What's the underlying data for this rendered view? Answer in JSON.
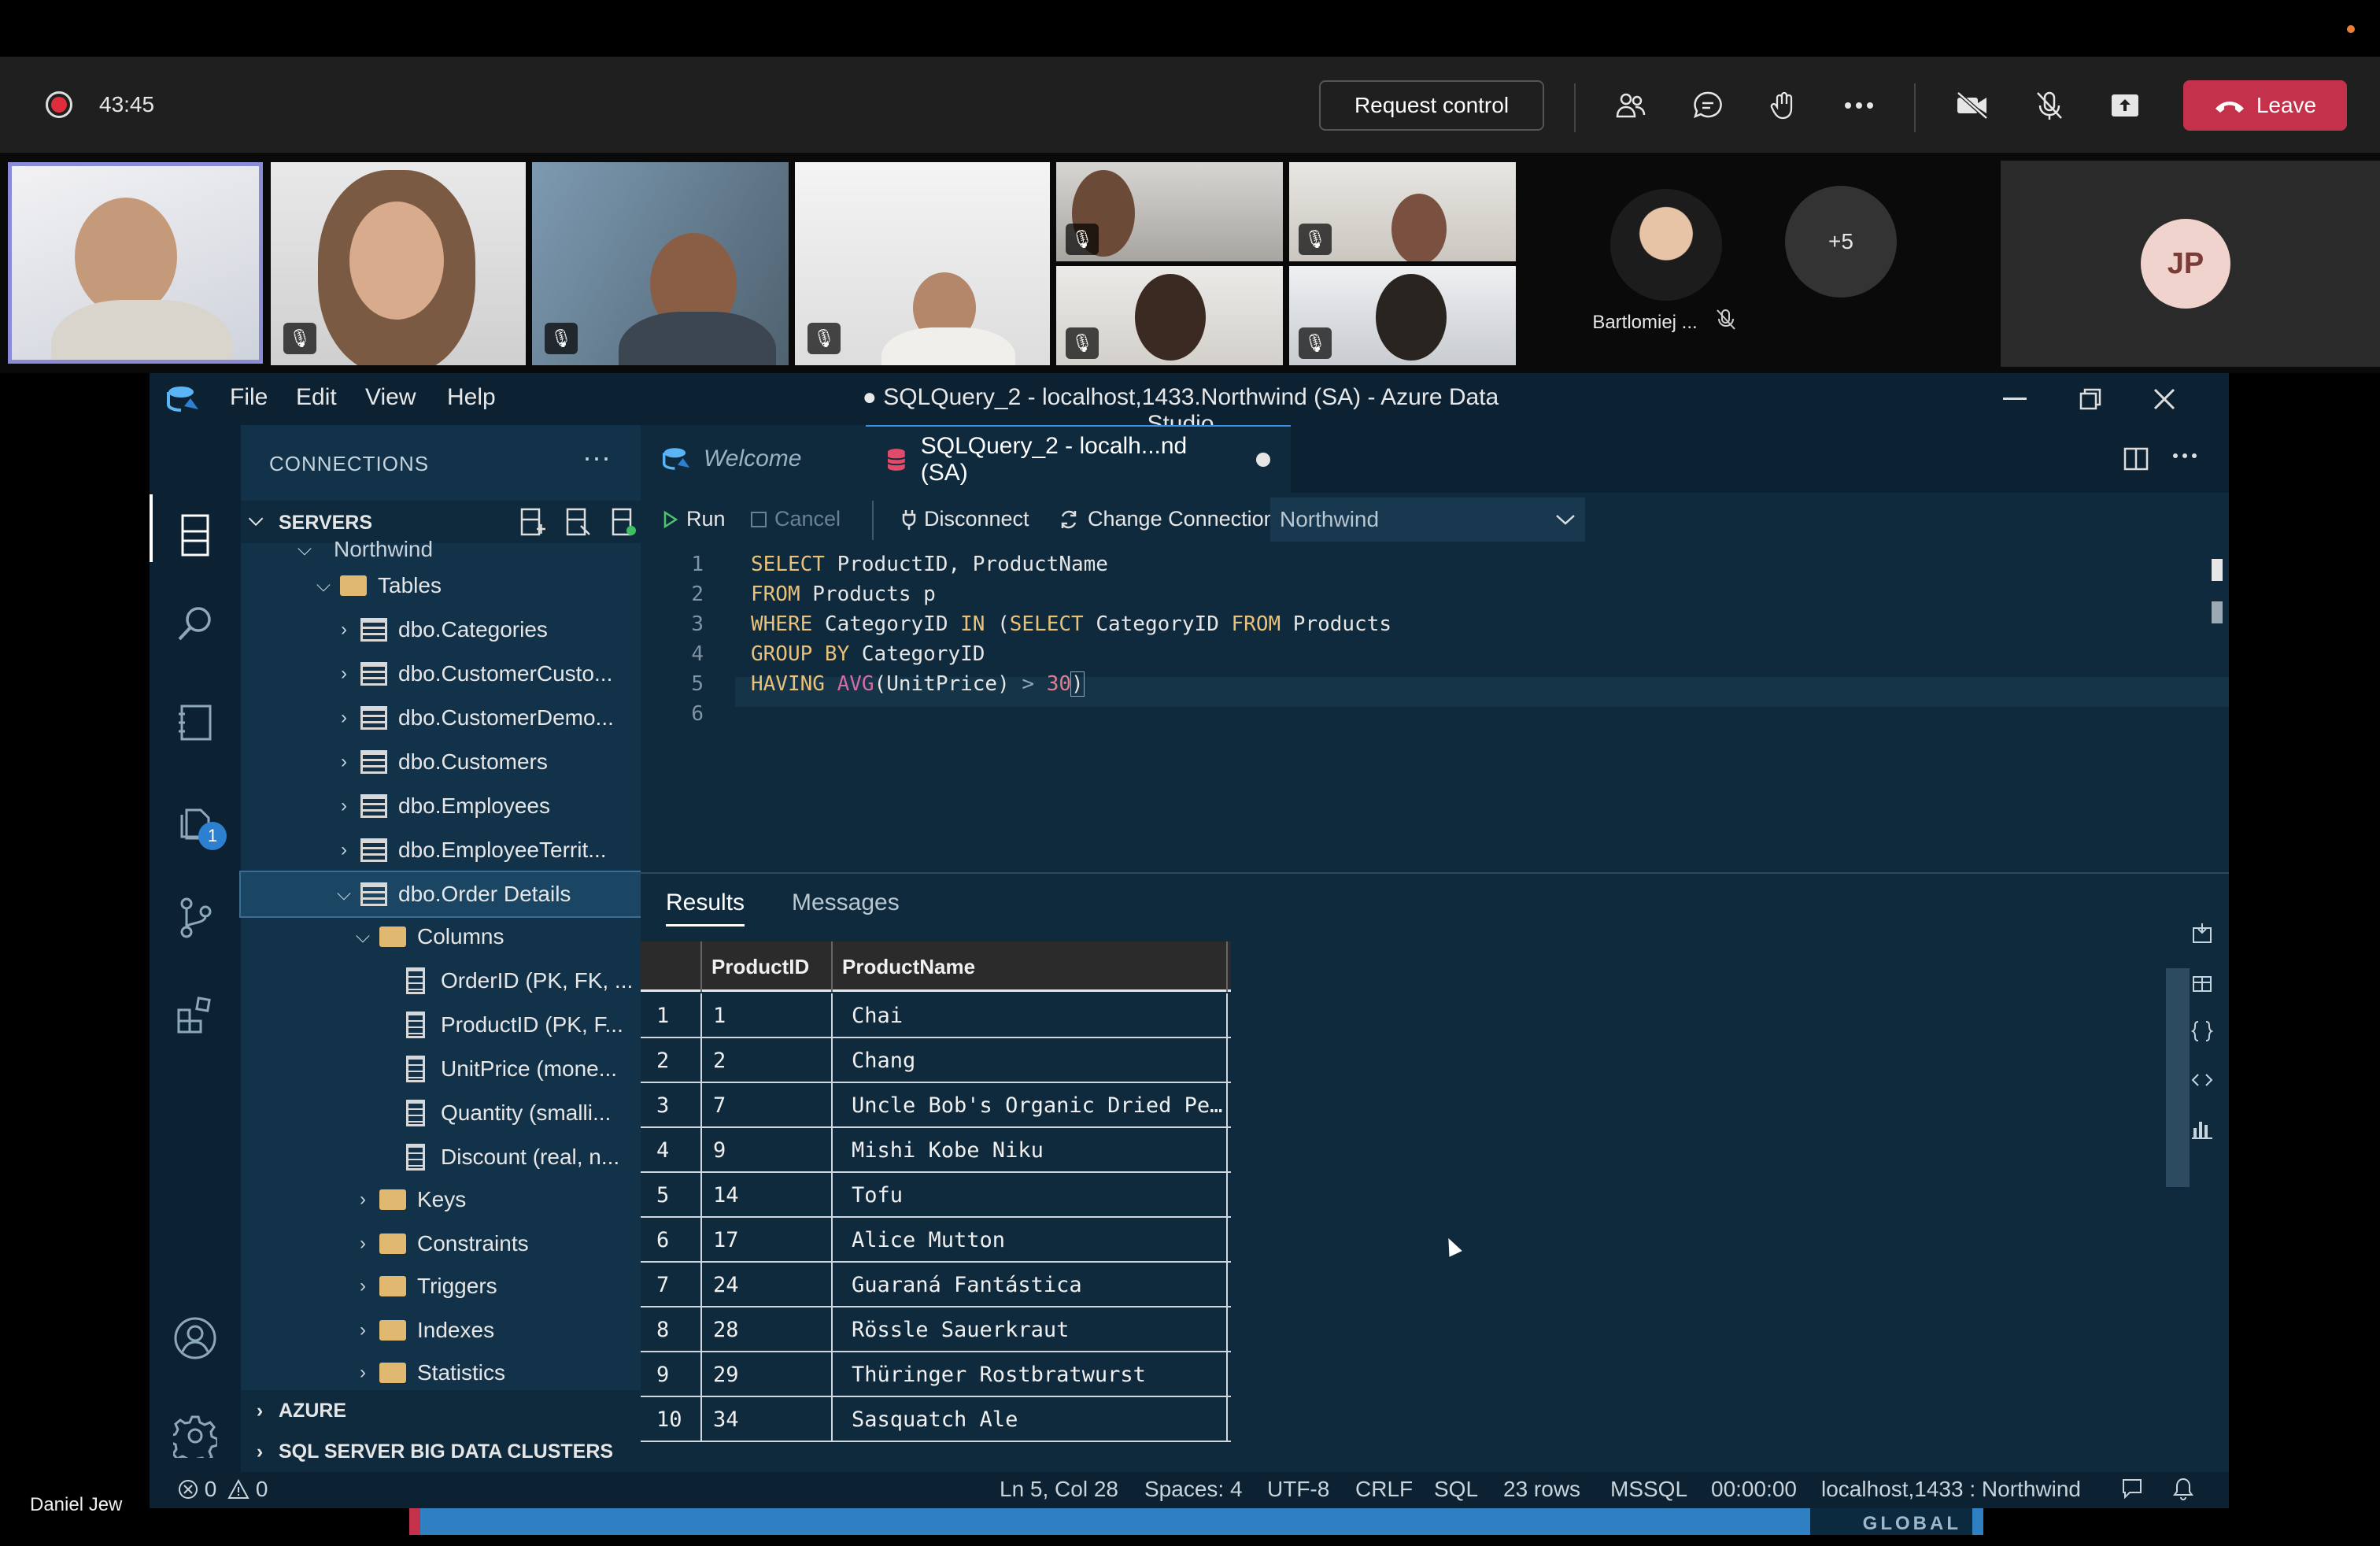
{
  "meeting": {
    "timer": "43:45",
    "request_control": "Request control",
    "leave": "Leave",
    "presenter_name": "Daniel Jew",
    "overflow_count": "+5",
    "named_participant": "Bartlomiej ...",
    "initials": "JP",
    "icons": [
      "people-icon",
      "chat-icon",
      "raise-hand-icon",
      "more-icon",
      "camera-off-icon",
      "mic-off-icon",
      "share-icon",
      "phone-icon"
    ]
  },
  "ads": {
    "window_title": "● SQLQuery_2 - localhost,1433.Northwind (SA) - Azure Data Studio",
    "menu": [
      "File",
      "Edit",
      "View",
      "Help"
    ],
    "connections_title": "CONNECTIONS",
    "servers": "SERVERS",
    "badge_count": "1",
    "tree": {
      "partial": "Northwind",
      "tables": "Tables",
      "items": [
        "dbo.Categories",
        "dbo.CustomerCusto...",
        "dbo.CustomerDemo...",
        "dbo.Customers",
        "dbo.Employees",
        "dbo.EmployeeTerrit...",
        "dbo.Order Details"
      ],
      "columns_folder": "Columns",
      "columns": [
        "OrderID (PK, FK, ...",
        "ProductID (PK, F...",
        "UnitPrice (mone...",
        "Quantity (smalli...",
        "Discount (real, n..."
      ],
      "folders": [
        "Keys",
        "Constraints",
        "Triggers",
        "Indexes",
        "Statistics"
      ]
    },
    "azure": "AZURE",
    "big_data": "SQL SERVER BIG DATA CLUSTERS",
    "tabs": {
      "welcome": "Welcome",
      "query": "SQLQuery_2 - localh...nd (SA)"
    },
    "toolbar": {
      "run": "Run",
      "cancel": "Cancel",
      "disconnect": "Disconnect",
      "change_connection": "Change Connection",
      "database": "Northwind"
    },
    "code": {
      "line_numbers": [
        "1",
        "2",
        "3",
        "4",
        "5",
        "6"
      ],
      "l1a": "SELECT",
      "l1b": " ProductID, ProductName",
      "l2a": "FROM",
      "l2b": " Products p",
      "l3a": "WHERE",
      "l3b": " CategoryID ",
      "l3c": "IN",
      "l3d": " (",
      "l3e": "SELECT",
      "l3f": " CategoryID ",
      "l3g": "FROM",
      "l3h": " Products",
      "l4a": "GROUP BY",
      "l4b": " CategoryID",
      "l5a": "HAVING",
      "l5b": " ",
      "l5c": "AVG",
      "l5d": "(UnitPrice) ",
      "l5e": ">",
      "l5f": " ",
      "l5g": "30",
      "l5h": ")"
    },
    "results": {
      "tab_results": "Results",
      "tab_messages": "Messages",
      "columns": [
        "ProductID",
        "ProductName"
      ],
      "rows": [
        [
          "1",
          "1",
          "Chai"
        ],
        [
          "2",
          "2",
          "Chang"
        ],
        [
          "3",
          "7",
          "Uncle Bob's Organic Dried Pe…"
        ],
        [
          "4",
          "9",
          "Mishi Kobe Niku"
        ],
        [
          "5",
          "14",
          "Tofu"
        ],
        [
          "6",
          "17",
          "Alice Mutton"
        ],
        [
          "7",
          "24",
          "Guaraná Fantástica"
        ],
        [
          "8",
          "28",
          "Rössle Sauerkraut"
        ],
        [
          "9",
          "29",
          "Thüringer Rostbratwurst"
        ],
        [
          "10",
          "34",
          "Sasquatch Ale"
        ]
      ]
    },
    "status": {
      "errors": "0",
      "warnings": "0",
      "position": "Ln 5, Col 28",
      "spaces": "Spaces: 4",
      "encoding": "UTF-8",
      "eol": "CRLF",
      "language": "SQL",
      "rows": "23 rows",
      "provider": "MSSQL",
      "elapsed": "00:00:00",
      "connection": "localhost,1433 : Northwind"
    }
  },
  "watermark": "GLOBAL",
  "colors": {
    "leave": "#c4314b",
    "accent": "#3a8ee6",
    "editor_bg": "#0f2a3d"
  }
}
